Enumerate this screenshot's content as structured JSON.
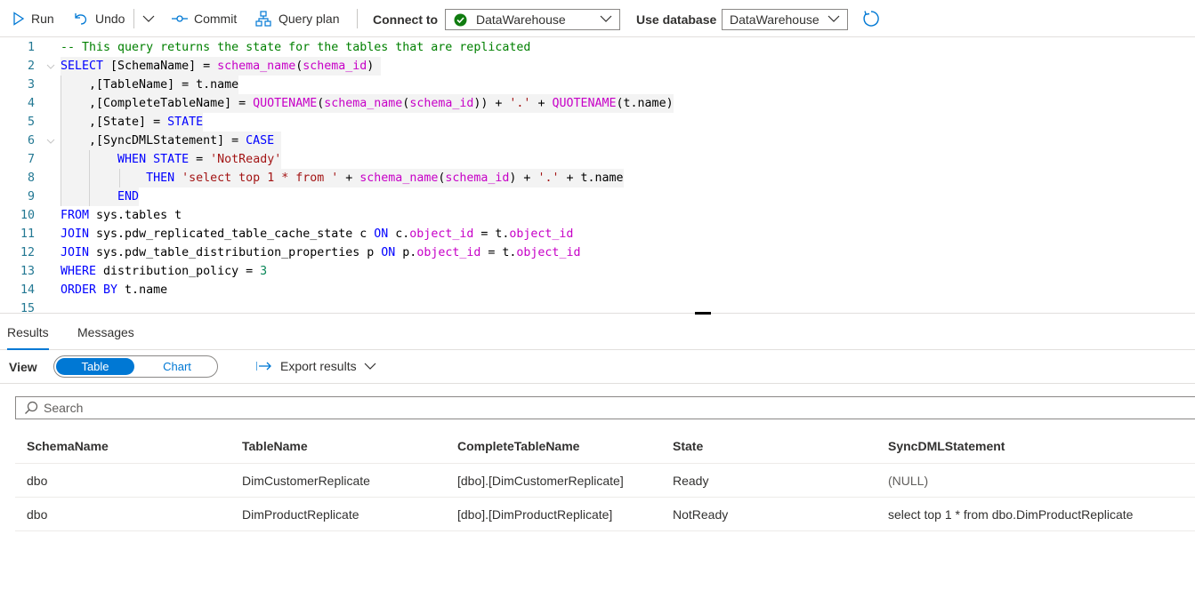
{
  "toolbar": {
    "run_label": "Run",
    "undo_label": "Undo",
    "commit_label": "Commit",
    "query_plan_label": "Query plan",
    "connect_to_label": "Connect to",
    "connect_to_value": "DataWarehouse",
    "use_database_label": "Use database",
    "use_database_value": "DataWarehouse"
  },
  "editor": {
    "line_numbers": [
      "1",
      "2",
      "3",
      "4",
      "5",
      "6",
      "7",
      "8",
      "9",
      "10",
      "11",
      "12",
      "13",
      "14",
      "15"
    ]
  },
  "results": {
    "tabs": [
      "Results",
      "Messages"
    ],
    "view_label": "View",
    "view_options": [
      "Table",
      "Chart"
    ],
    "export_label": "Export results",
    "search_placeholder": "Search",
    "columns": [
      "SchemaName",
      "TableName",
      "CompleteTableName",
      "State",
      "SyncDMLStatement"
    ],
    "rows": [
      [
        "dbo",
        "DimCustomerReplicate",
        "[dbo].[DimCustomerReplicate]",
        "Ready",
        "(NULL)"
      ],
      [
        "dbo",
        "DimProductReplicate",
        "[dbo].[DimProductReplicate]",
        "NotReady",
        "select top 1 * from dbo.DimProductReplicate"
      ]
    ]
  },
  "colors": {
    "accent": "#0078d4",
    "success": "#107c10",
    "keyword": "#0000ff",
    "string": "#a31515",
    "comment": "#008000",
    "function": "#795e26"
  },
  "icons": [
    "play-icon",
    "undo-icon",
    "chevron-down-icon",
    "commit-icon",
    "query-plan-icon",
    "check-circle-icon",
    "refresh-icon",
    "export-arrow-icon",
    "search-icon"
  ]
}
